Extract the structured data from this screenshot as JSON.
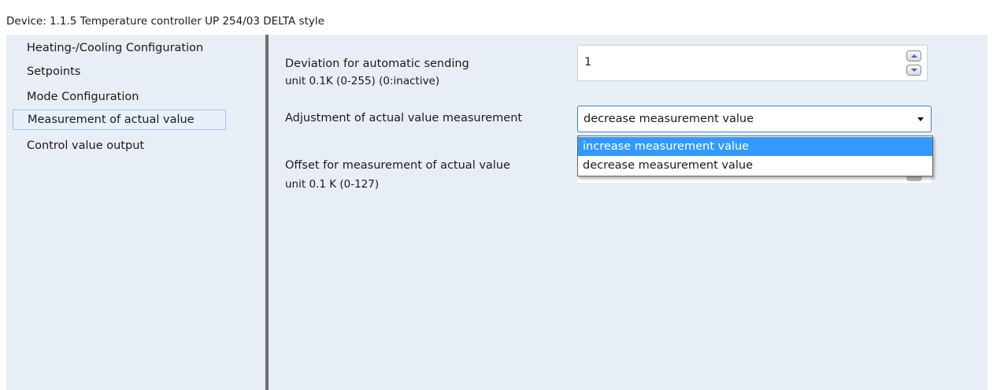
{
  "window": {
    "title": "Device: 1.1.5  Temperature controller UP 254/03 DELTA style"
  },
  "sidebar": {
    "items": [
      {
        "label": "Heating-/Cooling  Configuration",
        "selected": false
      },
      {
        "label": "Setpoints",
        "selected": false
      },
      {
        "label": "Mode  Configuration",
        "selected": false
      },
      {
        "label": "Measurement of actual value",
        "selected": true
      },
      {
        "label": "Control value output",
        "selected": false
      }
    ]
  },
  "params": {
    "deviation": {
      "label": "Deviation for automatic sending",
      "sublabel": "unit 0.1K  (0-255)  (0:inactive)",
      "value": "1"
    },
    "adjustment": {
      "label": "Adjustment of actual value measurement",
      "selected": "decrease measurement value",
      "options": [
        "increase measurement value",
        "decrease measurement value"
      ],
      "highlighted_option": "increase measurement value"
    },
    "offset": {
      "label": "Offset for measurement of actual value",
      "sublabel": "unit 0.1 K (0-127)"
    }
  },
  "colors": {
    "panel_bg": "#e8eef5",
    "selection_border": "#9cc1e6",
    "dropdown_highlight": "#3399ff",
    "combo_border": "#3f7fc4"
  }
}
